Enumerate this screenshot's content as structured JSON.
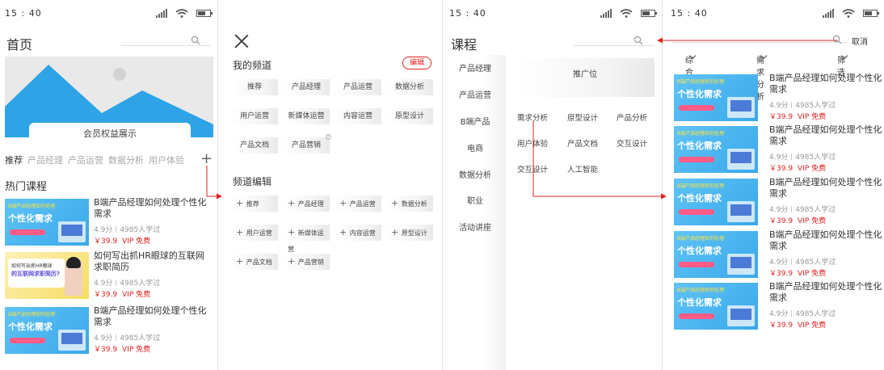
{
  "status": {
    "time": "15 : 40"
  },
  "screen1": {
    "title": "首页",
    "banner_label": "会员权益展示",
    "categories": [
      "推荐",
      "产品经理",
      "产品运营",
      "数据分析",
      "用户体验"
    ],
    "section_title": "热门课程",
    "courses": [
      {
        "title": "B端产品经理如何处理个性化需求",
        "rating": "4.9分",
        "learners": "4985人学过",
        "price": "￥39.9",
        "vip": "VIP 免费",
        "thumb_tag": "B端产品经理如何处理",
        "thumb_title": "个性化需求"
      },
      {
        "title": "如何写出抓HR眼球的互联网求职简历",
        "rating": "4.9分",
        "learners": "4985人学过",
        "price": "￥39.9",
        "vip": "VIP 免费",
        "thumb_tag": "如何写出抓HR眼球",
        "thumb_title": "的互联网求职简历?"
      },
      {
        "title": "B端产品经理如何处理个性化需求",
        "rating": "4.9分",
        "learners": "4985人学过",
        "price": "￥39.9",
        "vip": "VIP 免费",
        "thumb_tag": "B端产品经理如何处理",
        "thumb_title": "个性化需求"
      }
    ]
  },
  "screen2": {
    "my_channels_title": "我的频道",
    "edit_label": "编辑",
    "my_channels": [
      "推荐",
      "产品经理",
      "产品运营",
      "数据分析",
      "用户运营",
      "新媒体运营",
      "内容运营",
      "原型设计",
      "产品文档",
      "产品营销"
    ],
    "channel_edit_title": "频道编辑",
    "edit_channels": [
      "推荐",
      "产品经理",
      "产品运营",
      "数据分析",
      "用户运营",
      "新媒体运营",
      "内容运营",
      "原型设计",
      "产品文档",
      "产品营销"
    ]
  },
  "screen3": {
    "title": "课程",
    "sidebar": [
      "产品经理",
      "产品运营",
      "B端产品",
      "电商",
      "数据分析",
      "职业",
      "活动讲座"
    ],
    "promo_label": "推广位",
    "tags": [
      "需求分析",
      "原型设计",
      "产品分析",
      "用户体验",
      "产品文档",
      "交互设计",
      "交互设计",
      "人工智能"
    ]
  },
  "screen4": {
    "cancel_label": "取消",
    "filters": [
      "综合排序",
      "需求分析",
      "筛选"
    ],
    "courses": [
      {
        "title": "B端产品经理如何处理个性化需求",
        "rating": "4.9分",
        "learners": "4985人学过",
        "price": "￥39.9",
        "vip": "VIP 免费",
        "thumb_tag": "B端产品经理如何处理",
        "thumb_title": "个性化需求"
      },
      {
        "title": "B端产品经理如何处理个性化需求",
        "rating": "4.9分",
        "learners": "4985人学过",
        "price": "￥39.9",
        "vip": "VIP 免费",
        "thumb_tag": "B端产品经理如何处理",
        "thumb_title": "个性化需求"
      },
      {
        "title": "B端产品经理如何处理个性化需求",
        "rating": "4.9分",
        "learners": "4985人学过",
        "price": "￥39.9",
        "vip": "VIP 免费",
        "thumb_tag": "B端产品经理如何处理",
        "thumb_title": "个性化需求"
      },
      {
        "title": "B端产品经理如何处理个性化需求",
        "rating": "4.9分",
        "learners": "4985人学过",
        "price": "￥39.9",
        "vip": "VIP 免费",
        "thumb_tag": "B端产品经理如何处理",
        "thumb_title": "个性化需求"
      },
      {
        "title": "B端产品经理如何处理个性化需求",
        "rating": "4.9分",
        "learners": "4985人学过",
        "price": "￥39.9",
        "vip": "VIP 免费",
        "thumb_tag": "B端产品经理如何处理",
        "thumb_title": "个性化需求"
      }
    ]
  },
  "colors": {
    "accent_red": "#e02020",
    "thumb_blue": "#3aa8ea",
    "thumb_yellow": "#f7dc62",
    "banner_blue": "#2ea3e6"
  },
  "icons": [
    "search-icon",
    "signal-icon",
    "wifi-icon",
    "battery-icon",
    "close-icon",
    "plus-icon",
    "chevron-down-icon"
  ]
}
